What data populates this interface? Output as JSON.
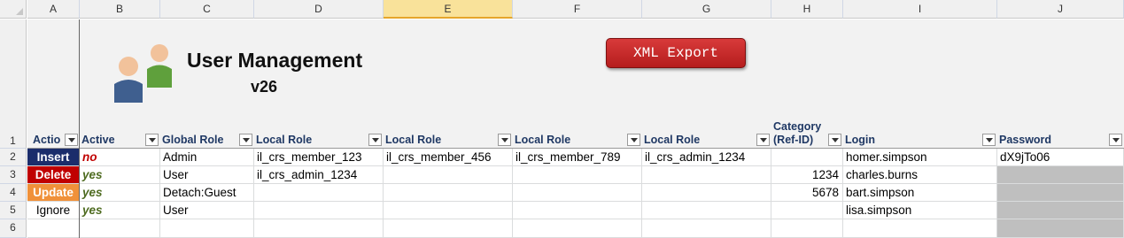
{
  "columns": [
    "A",
    "B",
    "C",
    "D",
    "E",
    "F",
    "G",
    "H",
    "I",
    "J"
  ],
  "rows": [
    "1",
    "2",
    "3",
    "4",
    "5",
    "6"
  ],
  "banner": {
    "title": "User Management",
    "version": "v26",
    "export_button": "XML Export"
  },
  "headers": {
    "action": "Actio",
    "active": "Active",
    "global_role": "Global Role",
    "local_role_1": "Local Role",
    "local_role_2": "Local Role",
    "local_role_3": "Local Role",
    "local_role_4": "Local Role",
    "category_1": "Category",
    "category_2": "(Ref-ID)",
    "login": "Login",
    "password": "Password"
  },
  "data": [
    {
      "action": "Insert",
      "active": "no",
      "global_role": "Admin",
      "local_role_1": "il_crs_member_123",
      "local_role_2": "il_crs_member_456",
      "local_role_3": "il_crs_member_789",
      "local_role_4": "il_crs_admin_1234",
      "category": "",
      "login": "homer.simpson",
      "password": "dX9jTo06"
    },
    {
      "action": "Delete",
      "active": "yes",
      "global_role": "User",
      "local_role_1": "il_crs_admin_1234",
      "local_role_2": "",
      "local_role_3": "",
      "local_role_4": "",
      "category": "1234",
      "login": "charles.burns",
      "password": ""
    },
    {
      "action": "Update",
      "active": "yes",
      "global_role": "Detach:Guest",
      "local_role_1": "",
      "local_role_2": "",
      "local_role_3": "",
      "local_role_4": "",
      "category": "5678",
      "login": "bart.simpson",
      "password": ""
    },
    {
      "action": "Ignore",
      "active": "yes",
      "global_role": "User",
      "local_role_1": "",
      "local_role_2": "",
      "local_role_3": "",
      "local_role_4": "",
      "category": "",
      "login": "lisa.simpson",
      "password": ""
    }
  ],
  "colors": {
    "insert": "#1b2d6b",
    "delete": "#c00000",
    "update": "#f0913a",
    "yes": "#4e6b20",
    "no": "#c00000",
    "export_button": "#c62828"
  }
}
